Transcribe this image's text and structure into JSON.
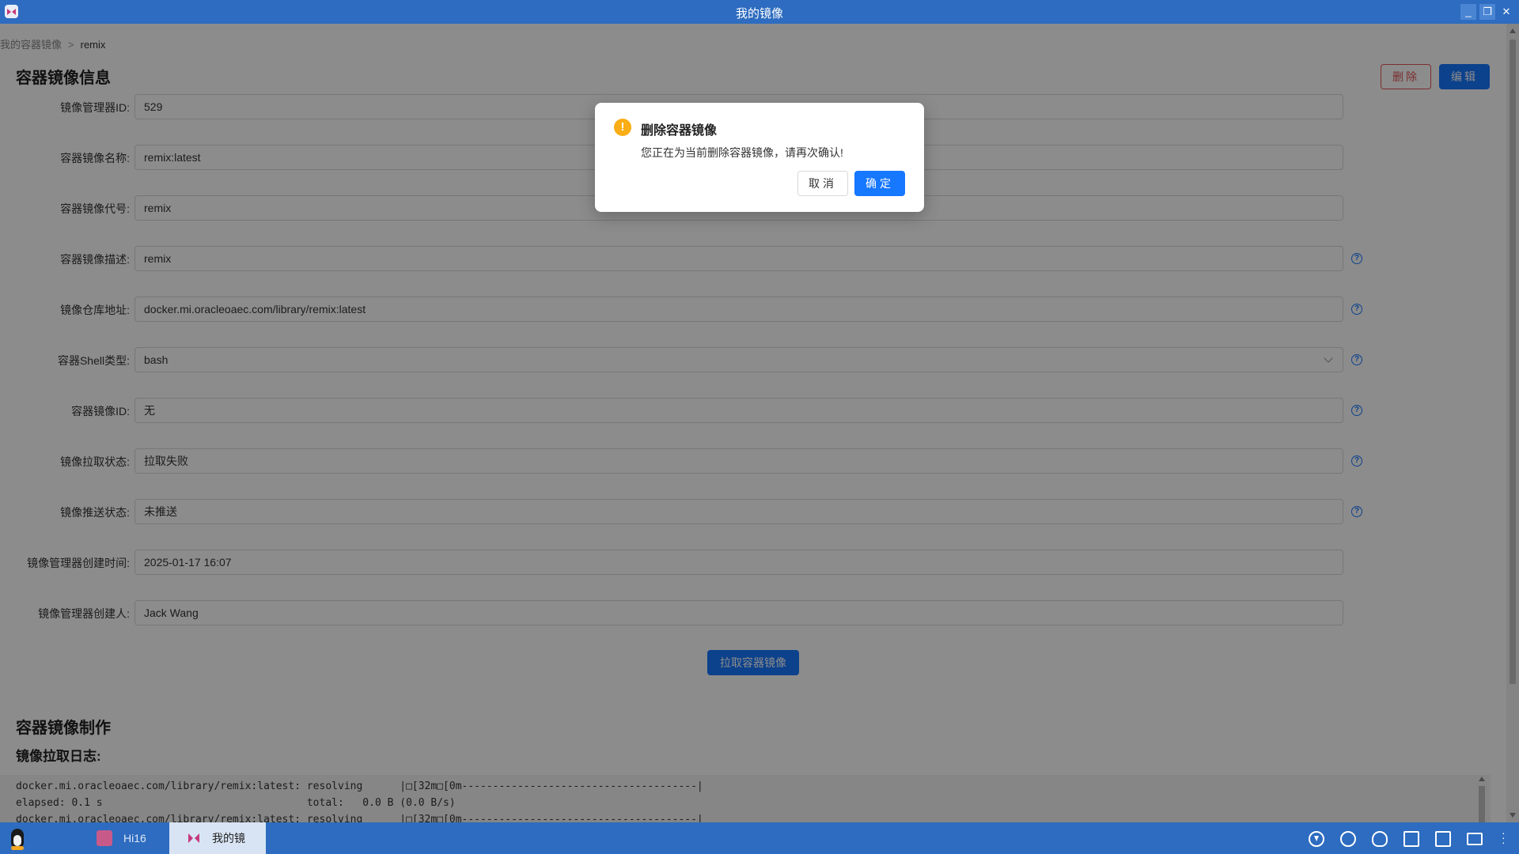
{
  "window": {
    "title": "我的镜像"
  },
  "breadcrumb": {
    "parent": "我的容器镜像",
    "separator": ">",
    "current": "remix"
  },
  "section": {
    "title": "容器镜像信息"
  },
  "actions": {
    "delete_label": "删除",
    "edit_label": "编辑"
  },
  "form": {
    "fields": [
      {
        "label": "镜像管理器ID:",
        "value": "529"
      },
      {
        "label": "容器镜像名称:",
        "value": "remix:latest"
      },
      {
        "label": "容器镜像代号:",
        "value": "remix"
      },
      {
        "label": "容器镜像描述:",
        "value": "remix"
      },
      {
        "label": "镜像仓库地址:",
        "value": "docker.mi.oracleoaec.com/library/remix:latest"
      },
      {
        "label": "容器Shell类型:",
        "value": "bash"
      },
      {
        "label": "容器镜像ID:",
        "value": "无"
      },
      {
        "label": "镜像拉取状态:",
        "value": "拉取失败"
      },
      {
        "label": "镜像推送状态:",
        "value": "未推送"
      },
      {
        "label": "镜像管理器创建时间:",
        "value": "2025-01-17 16:07"
      },
      {
        "label": "镜像管理器创建人:",
        "value": "Jack Wang"
      }
    ],
    "help_icon": "?"
  },
  "pull_button": "拉取容器镜像",
  "build_section": {
    "title": "容器镜像制作",
    "log_title": "镜像拉取日志:",
    "log_lines": [
      "docker.mi.oracleoaec.com/library/remix:latest: resolving      |□[32m□[0m--------------------------------------|",
      "elapsed: 0.1 s                                 total:   0.0 B (0.0 B/s)",
      "docker.mi.oracleoaec.com/library/remix:latest: resolving      |□[32m□[0m--------------------------------------|"
    ]
  },
  "modal": {
    "icon": "!",
    "title": "删除容器镜像",
    "content": "您正在为当前删除容器镜像，请再次确认!",
    "cancel_label": "取消",
    "ok_label": "确定"
  },
  "taskbar": {
    "tasks": [
      {
        "label": "Hi16"
      },
      {
        "label": "我的镜"
      }
    ]
  },
  "colors": {
    "titlebar": "#2d6cc0",
    "primary": "#1677ff",
    "danger": "#e05555",
    "warning": "#faad14"
  }
}
